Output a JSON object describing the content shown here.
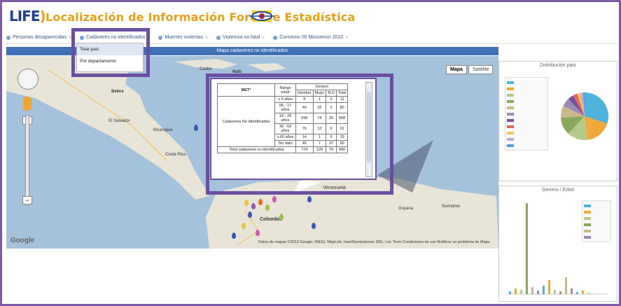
{
  "app": {
    "logo": "LIFE",
    "title": "Localización de Información Forense Estadística"
  },
  "tabs": [
    {
      "label": "Personas desaparecidas",
      "arrow": "»"
    },
    {
      "label": "Cadaveres no identificados",
      "arrow": "»"
    },
    {
      "label": "Muertes violentas",
      "arrow": "»"
    },
    {
      "label": "Violencia no fatal",
      "arrow": "»"
    },
    {
      "label": "Convenio 05 Ministerior 2010",
      "arrow": "»"
    }
  ],
  "dropdown": {
    "items": [
      "Total pais",
      "Por departamento"
    ]
  },
  "map": {
    "title": "Mapa cadaveres no identificados",
    "map_button": "Mapa",
    "satellite_button": "Satélite",
    "labels": [
      {
        "text": "Haiti",
        "style": "bold"
      },
      {
        "text": "Belice"
      },
      {
        "text": "Caribe"
      },
      {
        "text": "El Salvador"
      },
      {
        "text": "Nicaragua"
      },
      {
        "text": "Costa Rica"
      },
      {
        "text": "Venezuela"
      },
      {
        "text": "Colombia"
      },
      {
        "text": "Guyana"
      },
      {
        "text": "Suriname"
      }
    ],
    "attribution": "Datos de mapas ©2013 Google, INEGI, MapLink, Inav/Geosistemas SRL, Lat. Term.Condiciones de uso Notificar un problema de Maps",
    "google": "Google",
    "zoom_in": "+",
    "zoom_out": "−"
  },
  "popup": {
    "col_headers": {
      "met": "MET*",
      "rango": "Rango edad",
      "genero": "Genero",
      "hombre": "Hombre",
      "mujer": "Mujer",
      "nd": "N.D",
      "total": "Total"
    },
    "group_label": "Cadaveres No Identificados",
    "rows": [
      {
        "rango": "≤ 5 años",
        "hombre": "8",
        "mujer": "1",
        "nd": "0",
        "total": "12"
      },
      {
        "rango": "06 - 17 años",
        "hombre": "46",
        "mujer": "32",
        "nd": "2",
        "total": "80"
      },
      {
        "rango": "18 - 28 años",
        "hombre": "698",
        "mujer": "74",
        "nd": "25",
        "total": "808"
      },
      {
        "rango": "30 - 59 años",
        "hombre": "76",
        "mujer": "13",
        "nd": "0",
        "total": "91"
      },
      {
        "rango": "≥ 60 años",
        "hombre": "14",
        "mujer": "1",
        "nd": "0",
        "total": "15"
      },
      {
        "rango": "Sin dato",
        "hombre": "46",
        "mujer": "7",
        "nd": "37",
        "total": "80"
      }
    ],
    "total_row": {
      "label": "Total cadaveres no identificados",
      "hombre": "774",
      "mujer": "128",
      "nd": "79",
      "total": "890"
    }
  },
  "pie_panel": {
    "title": "Distribución país",
    "colors": [
      "#4fb3d9",
      "#f2a93b",
      "#b5c98a",
      "#8aa85a",
      "#c9b98a",
      "#9b8ab5",
      "#7a4f9c",
      "#e06b5b",
      "#f5c65a",
      "#c4a5d8",
      "#5a9ad0"
    ]
  },
  "bar_panel": {
    "title": "Genero / Edad",
    "colors": [
      "#4fb3d9",
      "#f2a93b",
      "#b5c98a",
      "#8aa85a",
      "#c9b98a",
      "#9b8ab5"
    ]
  },
  "accent": "#6b4fa0"
}
